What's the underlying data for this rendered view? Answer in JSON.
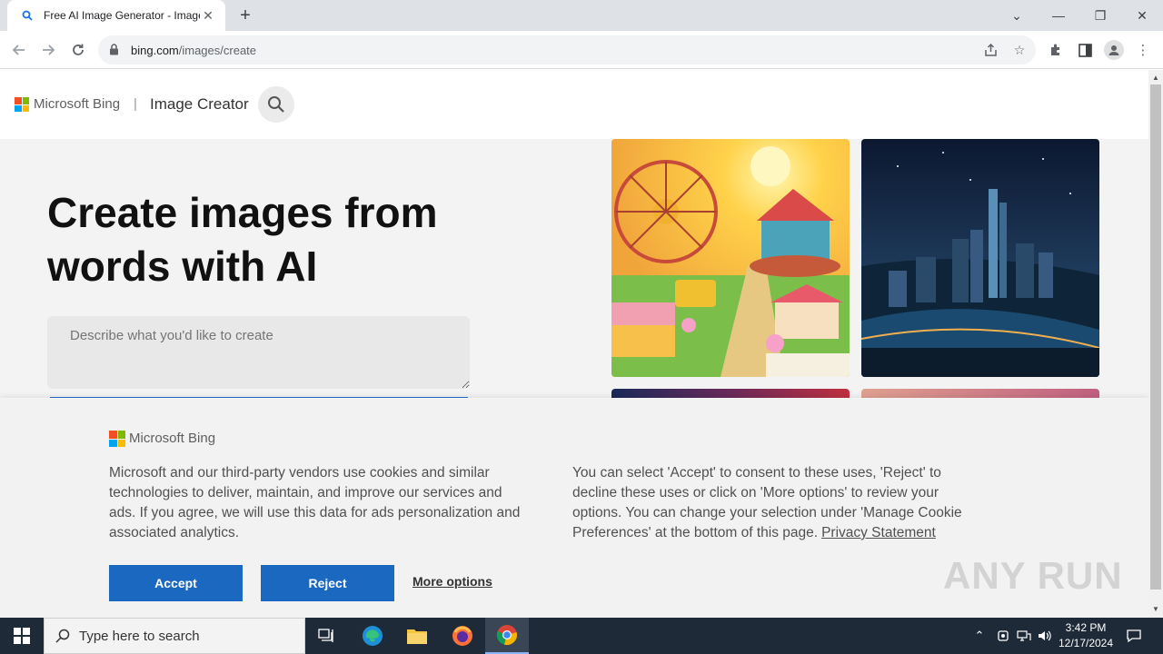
{
  "browser": {
    "tab_title": "Free AI Image Generator - Image Creator",
    "url_host": "bing.com",
    "url_path": "/images/create"
  },
  "page": {
    "brand": "Microsoft Bing",
    "separator": "|",
    "product": "Image Creator",
    "hero_title_line1": "Create images from",
    "hero_title_line2": "words with AI",
    "prompt_placeholder": "Describe what you'd like to create"
  },
  "cookie_banner": {
    "brand": "Microsoft Bing",
    "text_left": "Microsoft and our third-party vendors use cookies and similar technologies to deliver, maintain, and improve our services and ads. If you agree, we will use this data for ads personalization and associated analytics.",
    "text_right": "You can select 'Accept' to consent to these uses, 'Reject' to decline these uses or click on 'More options' to review your options. You can change your selection under 'Manage Cookie Preferences' at the bottom of this page.",
    "privacy_link": "Privacy Statement",
    "accept_label": "Accept",
    "reject_label": "Reject",
    "more_label": "More options"
  },
  "watermark": "ANY RUN",
  "taskbar": {
    "search_placeholder": "Type here to search",
    "time": "3:42 PM",
    "date": "12/17/2024"
  },
  "colors": {
    "accent": "#1b68c0",
    "ms_red": "#f25022",
    "ms_green": "#7fba00",
    "ms_blue": "#00a4ef",
    "ms_yellow": "#ffb900"
  }
}
